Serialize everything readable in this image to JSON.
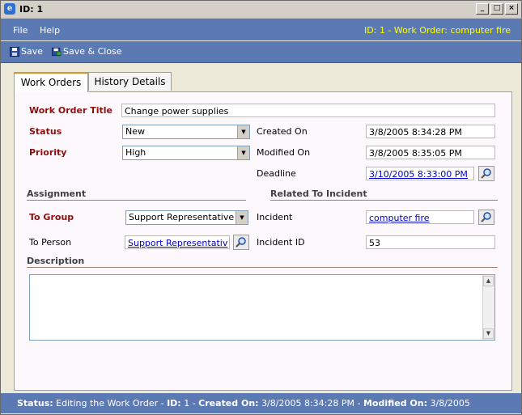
{
  "window": {
    "title": "ID: 1",
    "controls": [
      "_",
      "□",
      "×"
    ]
  },
  "menu": {
    "items": [
      "File",
      "Help"
    ],
    "caption": "ID: 1 - Work Order: computer fire"
  },
  "toolbar": {
    "save_label": "Save",
    "save_close_label": "Save & Close"
  },
  "tabs": [
    {
      "label": "Work Orders",
      "active": true
    },
    {
      "label": "History Details",
      "active": false
    }
  ],
  "form": {
    "title_label": "Work Order Title",
    "title_value": "Change power supplies",
    "status_label": "Status",
    "status_value": "New",
    "priority_label": "Priority",
    "priority_value": "High",
    "created_label": "Created On",
    "created_value": "3/8/2005 8:34:28 PM",
    "modified_label": "Modified On",
    "modified_value": "3/8/2005 8:35:05 PM",
    "deadline_label": "Deadline",
    "deadline_value": "3/10/2005 8:33:00 PM"
  },
  "assignment": {
    "heading": "Assignment",
    "group_label": "To Group",
    "group_value": "Support Representative",
    "person_label": "To Person",
    "person_value": "Support Representativ"
  },
  "incident": {
    "heading": "Related To Incident",
    "incident_label": "Incident",
    "incident_value": "computer fire",
    "id_label": "Incident ID",
    "id_value": "53"
  },
  "description": {
    "heading": "Description",
    "value": ""
  },
  "status": {
    "status_key": "Status:",
    "status_text": "Editing the Work Order -",
    "id_key": "ID:",
    "id_text": "1 -",
    "created_key": "Created On:",
    "created_text": "3/8/2005 8:34:28 PM -",
    "modified_key": "Modified On:",
    "modified_text": "3/8/2005"
  },
  "colors": {
    "menu_bg": "#5b7ab3",
    "required_label": "#8b1010",
    "caption": "#ffff00",
    "tab_accent": "#e0902a"
  }
}
